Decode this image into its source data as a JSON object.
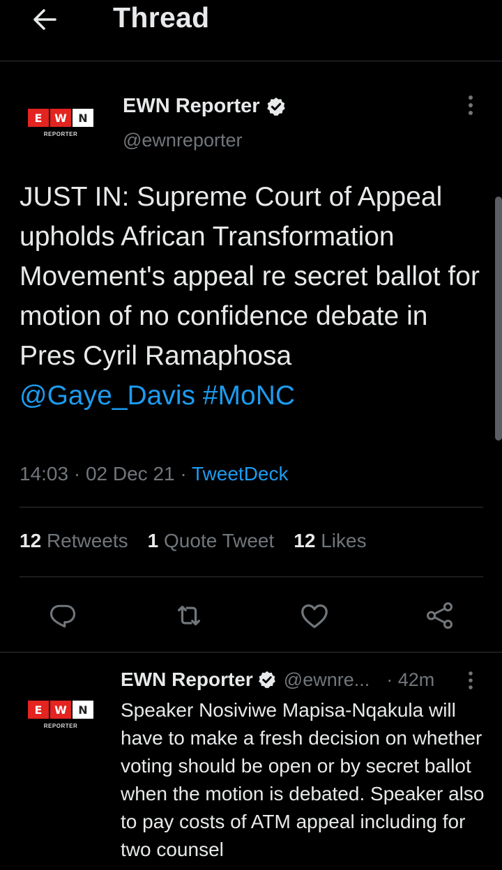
{
  "header": {
    "title": "Thread"
  },
  "main_tweet": {
    "logo": {
      "letters": [
        "E",
        "W",
        "N"
      ],
      "subtitle": "REPORTER"
    },
    "author_name": "EWN Reporter",
    "author_handle": "@ewnreporter",
    "text": "JUST IN: Supreme Court of Appeal upholds African Transformation Movement's appeal re secret ballot for motion of no confidence debate in Pres Cyril Ramaphosa",
    "mention": "@Gaye_Davis",
    "hashtag": "#MoNC",
    "time": "14:03",
    "date": "02 Dec 21",
    "separator": "·",
    "source": "TweetDeck",
    "stats": {
      "retweets_count": "12",
      "retweets_label": "Retweets",
      "quotes_count": "1",
      "quotes_label": "Quote Tweet",
      "likes_count": "12",
      "likes_label": "Likes"
    }
  },
  "reply": {
    "logo": {
      "letters": [
        "E",
        "W",
        "N"
      ],
      "subtitle": "REPORTER"
    },
    "author_name": "EWN Reporter",
    "author_handle": "@ewnre...",
    "time": "· 42m",
    "text": "Speaker Nosiviwe Mapisa-Nqakula will have to make a fresh decision on whether voting should be open or by secret ballot when the motion is debated. Speaker also to pay costs of ATM appeal including for two counsel"
  },
  "colors": {
    "background": "#000000",
    "text": "#e7e9ea",
    "muted": "#71767b",
    "accent": "#1d9bf0",
    "divider": "#2f3336",
    "logo_red": "#e32421"
  },
  "icons": {
    "back": "arrow-left-icon",
    "verified": "verified-badge-icon",
    "more": "more-vertical-icon",
    "reply": "reply-icon",
    "retweet": "retweet-icon",
    "like": "heart-icon",
    "share": "share-icon"
  }
}
